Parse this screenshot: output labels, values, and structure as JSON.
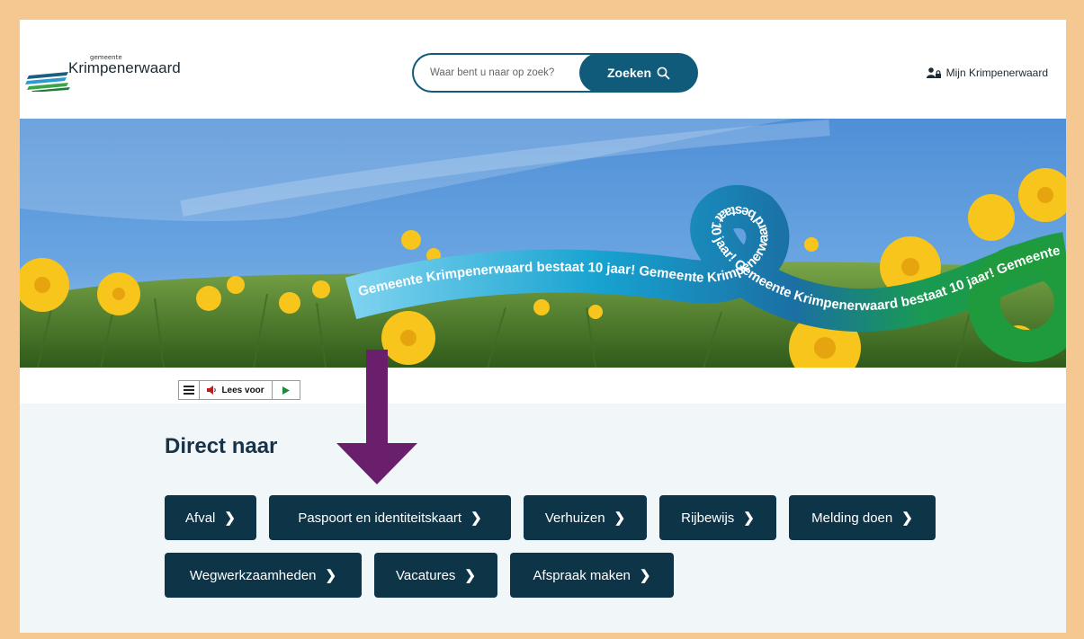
{
  "header": {
    "logo_small": "gemeente",
    "logo_name": "Krimpenerwaard",
    "search": {
      "placeholder": "Waar bent u naar op zoek?",
      "button_label": "Zoeken"
    },
    "account_label": "Mijn Krimpenerwaard"
  },
  "hero": {
    "ribbon_text": "Gemeente Krimpenerwaard bestaat 10 jaar! Gemeente Krimpenerwaard bestaat 10 jaar! Gemeente Krimpenerwaard bestaat 10 jaar! Gemeente Krimpener"
  },
  "readbar": {
    "label": "Lees voor"
  },
  "direct": {
    "title": "Direct naar",
    "links": [
      "Afval",
      "Paspoort en identiteitskaart",
      "Verhuizen",
      "Rijbewijs",
      "Melding doen",
      "Wegwerkzaamheden",
      "Vacatures",
      "Afspraak maken"
    ]
  },
  "colors": {
    "frame": "#f5c892",
    "primary": "#0f5b79",
    "button": "#0e3447",
    "arrow": "#6a1f6c",
    "section_bg": "#f1f6f9"
  }
}
